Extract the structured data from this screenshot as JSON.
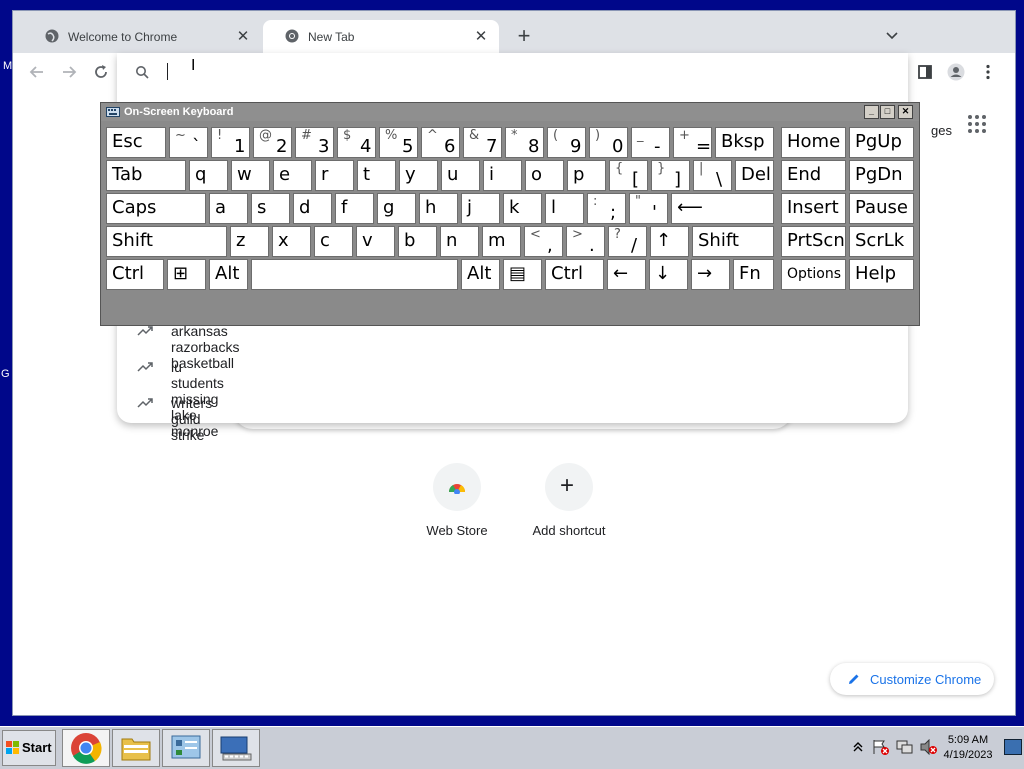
{
  "desktop": {
    "left_glyph_1": "M",
    "left_glyph_2": "G"
  },
  "tabs": [
    {
      "label": "Welcome to Chrome",
      "active": false
    },
    {
      "label": "New Tab",
      "active": true
    }
  ],
  "omnibox": {
    "value": ""
  },
  "apps_partial_text": "ges",
  "suggestions": [
    "arkansas razorbacks basketball",
    "iu students missing lake monroe",
    "writers guild strike"
  ],
  "shortcuts": [
    {
      "label": "Web Store",
      "icon": "chrome-web-store-icon"
    },
    {
      "label": "Add shortcut",
      "icon": "plus-icon"
    }
  ],
  "customize_label": "Customize Chrome",
  "osk": {
    "title": "On-Screen Keyboard",
    "rows": [
      [
        {
          "m": "Esc"
        },
        {
          "s": "~",
          "b": "`"
        },
        {
          "s": "!",
          "b": "1"
        },
        {
          "s": "@",
          "b": "2"
        },
        {
          "s": "#",
          "b": "3"
        },
        {
          "s": "$",
          "b": "4"
        },
        {
          "s": "%",
          "b": "5"
        },
        {
          "s": "^",
          "b": "6"
        },
        {
          "s": "&",
          "b": "7"
        },
        {
          "s": "*",
          "b": "8"
        },
        {
          "s": "(",
          "b": "9"
        },
        {
          "s": ")",
          "b": "0"
        },
        {
          "s": "_",
          "b": "-"
        },
        {
          "s": "+",
          "b": "="
        },
        {
          "m": "Bksp"
        },
        {
          "m": "Home"
        },
        {
          "m": "PgUp"
        }
      ],
      [
        {
          "m": "Tab"
        },
        {
          "m": "q"
        },
        {
          "m": "w"
        },
        {
          "m": "e"
        },
        {
          "m": "r"
        },
        {
          "m": "t"
        },
        {
          "m": "y"
        },
        {
          "m": "u"
        },
        {
          "m": "i"
        },
        {
          "m": "o"
        },
        {
          "m": "p"
        },
        {
          "s": "{",
          "b": "["
        },
        {
          "s": "}",
          "b": "]"
        },
        {
          "s": "|",
          "b": "\\"
        },
        {
          "m": "Del"
        },
        {
          "m": "End"
        },
        {
          "m": "PgDn"
        }
      ],
      [
        {
          "m": "Caps"
        },
        {
          "m": "a"
        },
        {
          "m": "s"
        },
        {
          "m": "d"
        },
        {
          "m": "f"
        },
        {
          "m": "g"
        },
        {
          "m": "h"
        },
        {
          "m": "j"
        },
        {
          "m": "k"
        },
        {
          "m": "l"
        },
        {
          "s": ":",
          "b": ";"
        },
        {
          "s": "\"",
          "b": "'"
        },
        {
          "m": "⟵"
        },
        {
          "m": "Insert"
        },
        {
          "m": "Pause"
        }
      ],
      [
        {
          "m": "Shift"
        },
        {
          "m": "z"
        },
        {
          "m": "x"
        },
        {
          "m": "c"
        },
        {
          "m": "v"
        },
        {
          "m": "b"
        },
        {
          "m": "n"
        },
        {
          "m": "m"
        },
        {
          "s": "<",
          "b": ","
        },
        {
          "s": ">",
          "b": "."
        },
        {
          "s": "?",
          "b": "/"
        },
        {
          "m": "↑"
        },
        {
          "m": "Shift"
        },
        {
          "m": "PrtScn"
        },
        {
          "m": "ScrLk"
        }
      ],
      [
        {
          "m": "Ctrl"
        },
        {
          "m": "⊞"
        },
        {
          "m": "Alt"
        },
        {
          "m": ""
        },
        {
          "m": "Alt"
        },
        {
          "m": "▤"
        },
        {
          "m": "Ctrl"
        },
        {
          "m": "←"
        },
        {
          "m": "↓"
        },
        {
          "m": "→"
        },
        {
          "m": "Fn"
        },
        {
          "m": "Options"
        },
        {
          "m": "Help"
        }
      ]
    ]
  },
  "taskbar": {
    "start_label": "Start",
    "clock_time": "5:09 AM",
    "clock_date": "4/19/2023"
  }
}
